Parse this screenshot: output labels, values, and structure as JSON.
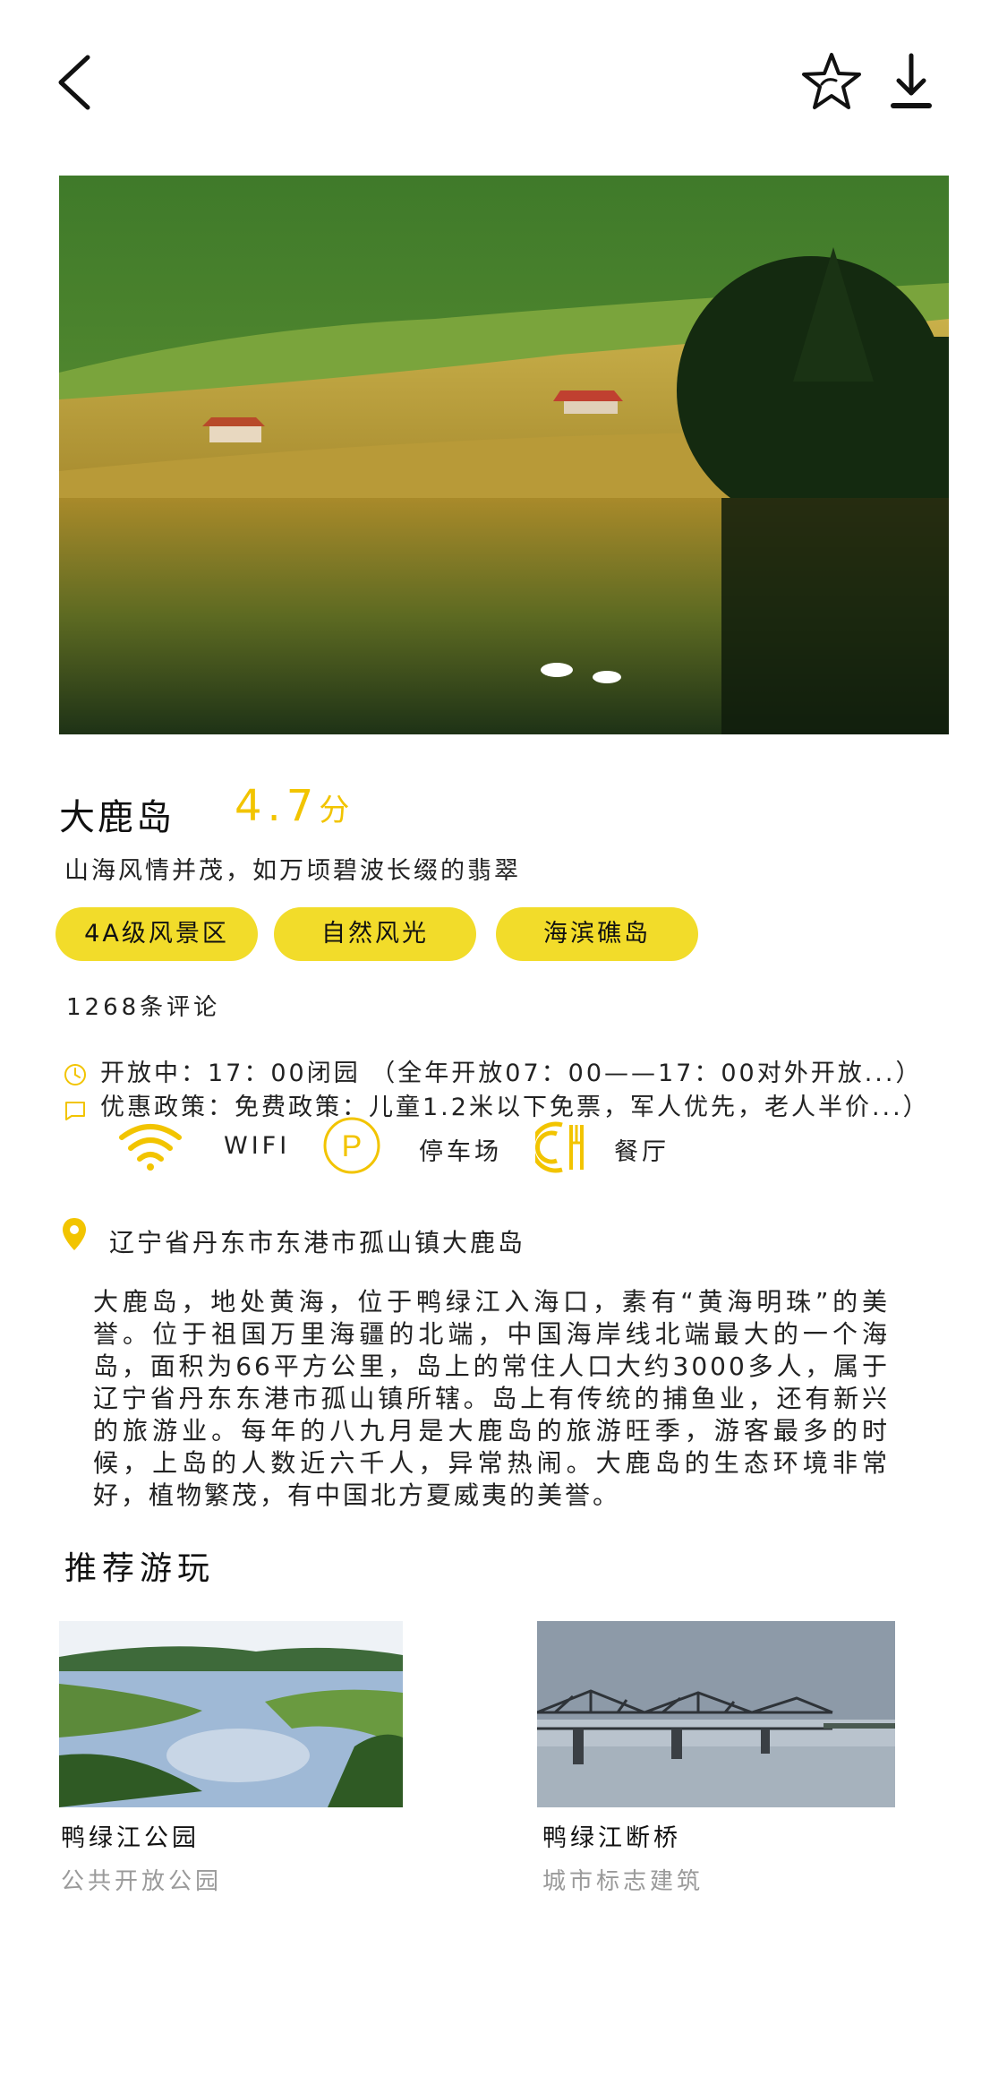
{
  "nav": {
    "back_icon": "chevron-left-icon",
    "favorite_icon": "star-outline-icon",
    "download_icon": "download-icon"
  },
  "hero": {
    "image": "landscape-lake-village-photo"
  },
  "spot": {
    "name": "大鹿岛",
    "score": "4.7",
    "score_unit": "分",
    "slogan": "山海风情并茂，如万顷碧波长缀的翡翠",
    "tags": [
      "4A级风景区",
      "自然风光",
      "海滨礁岛"
    ],
    "reviews": "1268条评论",
    "hours": "开放中：17：00闭园 （全年开放07：00——17：00对外开放...）",
    "policy": "优惠政策：免费政策：儿童1.2米以下免票，军人优先，老人半价...）",
    "facilities": [
      {
        "icon": "wifi-icon",
        "label": "WIFI"
      },
      {
        "icon": "parking-icon",
        "label": "停车场"
      },
      {
        "icon": "restaurant-icon",
        "label": "餐厅"
      }
    ],
    "address": "辽宁省丹东市东港市孤山镇大鹿岛",
    "description": "大鹿岛，地处黄海，位于鸭绿江入海口，素有“黄海明珠”的美誉。位于祖国万里海疆的北端，中国海岸线北端最大的一个海岛，面积为66平方公里，岛上的常住人口大约3000多人，属于辽宁省丹东东港市孤山镇所辖。岛上有传统的捕鱼业，还有新兴的旅游业。每年的八九月是大鹿岛的旅游旺季，游客最多的时候，上岛的人数近六千人，异常热闹。大鹿岛的生态环境非常好，植物繁茂，有中国北方夏威夷的美誉。"
  },
  "recommend": {
    "title": "推荐游玩",
    "items": [
      {
        "title": "鸭绿江公园",
        "subtitle": "公共开放公园"
      },
      {
        "title": "鸭绿江断桥",
        "subtitle": "城市标志建筑"
      }
    ]
  },
  "colors": {
    "accent": "#f2c400",
    "tag_bg": "#f2dc2a",
    "muted": "#9a9a9a"
  }
}
